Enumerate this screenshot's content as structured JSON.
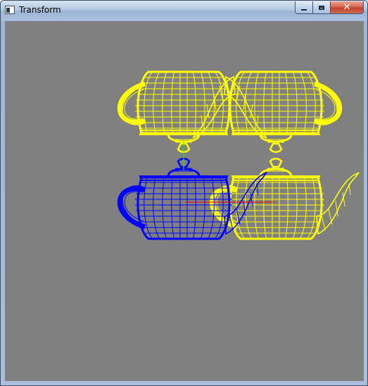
{
  "window": {
    "title": "Transform"
  },
  "titlebar": {
    "icon": "app-window-icon",
    "controls": [
      {
        "name": "minimize",
        "icon": "minimize-icon"
      },
      {
        "name": "maximize",
        "icon": "maximize-icon"
      },
      {
        "name": "close",
        "icon": "close-icon",
        "glyph": "✕"
      }
    ]
  },
  "viewport": {
    "background": "#808080",
    "teapots": [
      {
        "name": "top-left-teapot",
        "color": "#ffff00",
        "orientation": "upside-down"
      },
      {
        "name": "top-right-teapot",
        "color": "#ffff00",
        "orientation": "upside-down-mirrored"
      },
      {
        "name": "bottom-left-teapot",
        "color": "#0000ff",
        "orientation": "mirrored"
      },
      {
        "name": "bottom-right-teapot",
        "color": "#ffff00",
        "orientation": "upright"
      }
    ],
    "axes": [
      {
        "name": "x-axis",
        "color": "#ff0000"
      },
      {
        "name": "y-axis",
        "color": "#00ff00"
      }
    ]
  }
}
